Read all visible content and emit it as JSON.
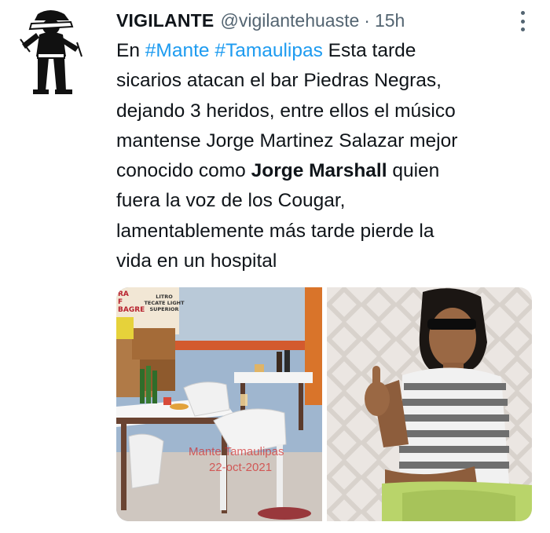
{
  "tweet": {
    "author_name": "VIGILANTE",
    "handle": "@vigilantehuaste",
    "separator": "·",
    "time": "15h",
    "avatar_icon": "person-figure-avatar",
    "more_icon": "vertical-ellipsis-icon",
    "text": {
      "l1_prefix": "En ",
      "hashtag_1": "#Mante",
      "l1_space": " ",
      "hashtag_2": "#Tamaulipas",
      "l1_suffix": " Esta tarde",
      "l2": "sicarios atacan el bar Piedras Negras,",
      "l3": "dejando 3 heridos, entre ellos el músico",
      "l4": "mantense Jorge Martinez Salazar mejor",
      "l5_prefix": "conocido como ",
      "l5_bold": "Jorge Marshall",
      "l5_suffix": " quien",
      "l6": "fuera la voz de los Cougar,",
      "l7": "lamentablemente más tarde pierde la",
      "l8": "vida en un hospital"
    },
    "media": {
      "left_watermark_line1": "Mante Tamaulipas",
      "left_watermark_line2": "22-oct-2021",
      "sign_lines": [
        "LITRO",
        "TECATE LIGHT",
        "SUPERIOR"
      ],
      "sign_left_lines": [
        "RA",
        "F",
        "BAGRE"
      ]
    },
    "colors": {
      "hashtag": "#1d9bf0",
      "secondary_text": "#536471",
      "primary_text": "#0f1419"
    }
  }
}
